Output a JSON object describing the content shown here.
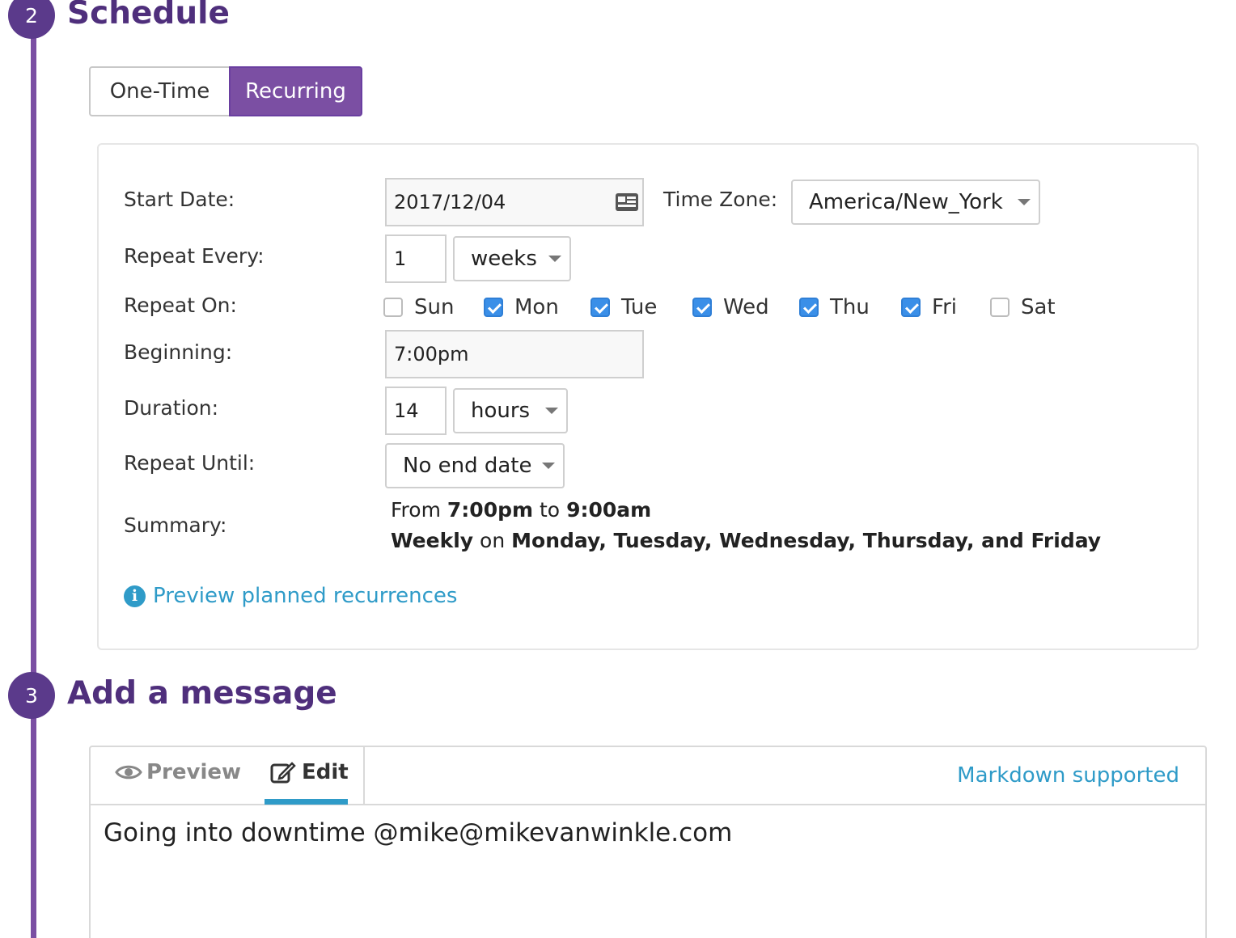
{
  "steps": [
    {
      "number": "2",
      "title": "Schedule"
    },
    {
      "number": "3",
      "title": "Add a message"
    }
  ],
  "schedule_type": {
    "options": [
      "One-Time",
      "Recurring"
    ],
    "selected": "Recurring"
  },
  "form": {
    "start_date": {
      "label": "Start Date:",
      "value": "2017/12/04",
      "icon": "calendar-icon"
    },
    "time_zone": {
      "label": "Time Zone:",
      "value": "America/New_York"
    },
    "repeat_every": {
      "label": "Repeat Every:",
      "value": "1",
      "unit": "weeks"
    },
    "repeat_on": {
      "label": "Repeat On:",
      "days": [
        {
          "label": "Sun",
          "checked": false
        },
        {
          "label": "Mon",
          "checked": true
        },
        {
          "label": "Tue",
          "checked": true
        },
        {
          "label": "Wed",
          "checked": true
        },
        {
          "label": "Thu",
          "checked": true
        },
        {
          "label": "Fri",
          "checked": true
        },
        {
          "label": "Sat",
          "checked": false
        }
      ]
    },
    "beginning": {
      "label": "Beginning:",
      "value": "7:00pm"
    },
    "duration": {
      "label": "Duration:",
      "value": "14",
      "unit": "hours"
    },
    "repeat_until": {
      "label": "Repeat Until:",
      "value": "No end date"
    },
    "summary": {
      "label": "Summary:",
      "line1": {
        "prefix": "From",
        "from": "7:00pm",
        "mid": "to",
        "to": "9:00am"
      },
      "line2": {
        "frequency": "Weekly",
        "mid": "on",
        "days": "Monday, Tuesday, Wednesday, Thursday, and Friday"
      }
    },
    "preview_link": "Preview planned recurrences"
  },
  "message": {
    "tabs": [
      {
        "label": "Preview",
        "icon": "eye-icon"
      },
      {
        "label": "Edit",
        "icon": "edit-icon",
        "active": true
      }
    ],
    "markdown_note": "Markdown supported",
    "text": "Going into downtime  @mike@mikevanwinkle.com"
  },
  "colors": {
    "accent_purple": "#7b4fa3",
    "title_purple": "#4f2f7c",
    "link_blue": "#2f9bc8",
    "checkbox_blue": "#3a8fe8"
  }
}
